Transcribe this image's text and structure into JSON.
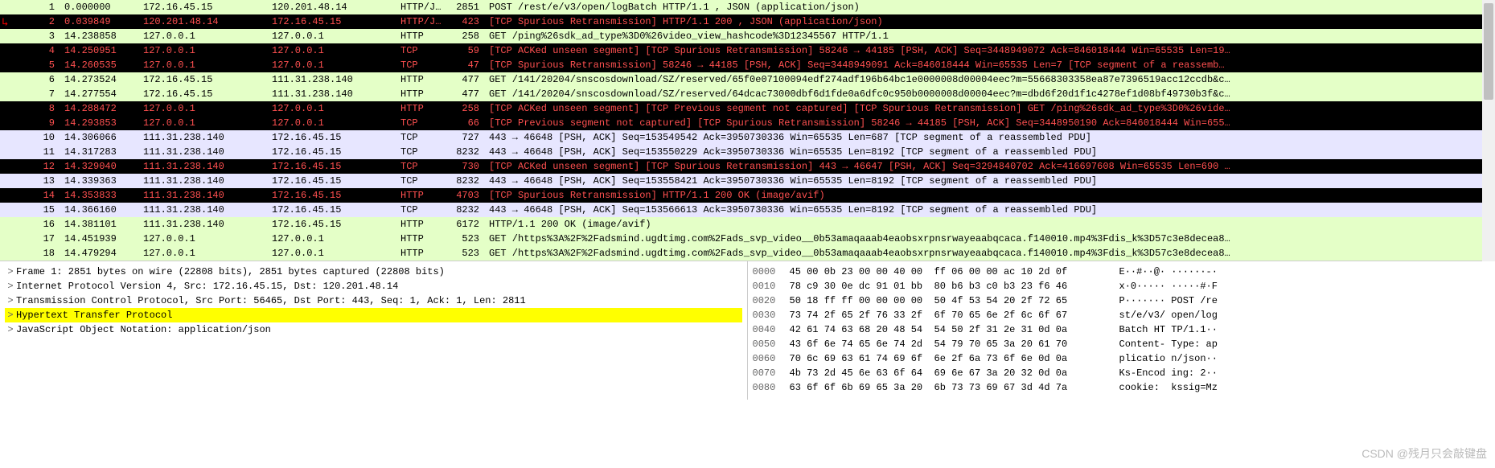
{
  "packets": [
    {
      "cls": "normal",
      "num": "1",
      "time": "0.000000",
      "src": "172.16.45.15",
      "dst": "120.201.48.14",
      "proto": "HTTP/J…",
      "len": "2851",
      "info": "POST /rest/e/v3/open/logBatch HTTP/1.1 , JSON (application/json)"
    },
    {
      "cls": "spurious",
      "num": "2",
      "time": "0.039849",
      "src": "120.201.48.14",
      "dst": "172.16.45.15",
      "proto": "HTTP/J…",
      "len": "423",
      "info": "[TCP Spurious Retransmission] HTTP/1.1 200  , JSON (application/json)"
    },
    {
      "cls": "normal",
      "num": "3",
      "time": "14.238858",
      "src": "127.0.0.1",
      "dst": "127.0.0.1",
      "proto": "HTTP",
      "len": "258",
      "info": "GET /ping%26sdk_ad_type%3D0%26video_view_hashcode%3D12345567 HTTP/1.1"
    },
    {
      "cls": "spurious",
      "num": "4",
      "time": "14.250951",
      "src": "127.0.0.1",
      "dst": "127.0.0.1",
      "proto": "TCP",
      "len": "59",
      "info": "[TCP ACKed unseen segment] [TCP Spurious Retransmission] 58246 → 44185 [PSH, ACK] Seq=3448949072 Ack=846018444 Win=65535 Len=19…"
    },
    {
      "cls": "spurious",
      "num": "5",
      "time": "14.260535",
      "src": "127.0.0.1",
      "dst": "127.0.0.1",
      "proto": "TCP",
      "len": "47",
      "info": "[TCP Spurious Retransmission] 58246 → 44185 [PSH, ACK] Seq=3448949091 Ack=846018444 Win=65535 Len=7 [TCP segment of a reassemb…"
    },
    {
      "cls": "normal",
      "num": "6",
      "time": "14.273524",
      "src": "172.16.45.15",
      "dst": "111.31.238.140",
      "proto": "HTTP",
      "len": "477",
      "info": "GET /141/20204/snscosdownload/SZ/reserved/65f0e07100094edf274adf196b64bc1e0000008d00004eec?m=55668303358ea87e7396519acc12ccdb&c…"
    },
    {
      "cls": "normal",
      "num": "7",
      "time": "14.277554",
      "src": "172.16.45.15",
      "dst": "111.31.238.140",
      "proto": "HTTP",
      "len": "477",
      "info": "GET /141/20204/snscosdownload/SZ/reserved/64dcac73000dbf6d1fde0a6dfc0c950b0000008d00004eec?m=dbd6f20d1f1c4278ef1d08bf49730b3f&c…"
    },
    {
      "cls": "spurious",
      "num": "8",
      "time": "14.288472",
      "src": "127.0.0.1",
      "dst": "127.0.0.1",
      "proto": "HTTP",
      "len": "258",
      "info": "[TCP ACKed unseen segment] [TCP Previous segment not captured] [TCP Spurious Retransmission] GET /ping%26sdk_ad_type%3D0%26vide…"
    },
    {
      "cls": "spurious",
      "num": "9",
      "time": "14.293853",
      "src": "127.0.0.1",
      "dst": "127.0.0.1",
      "proto": "TCP",
      "len": "66",
      "info": "[TCP Previous segment not captured] [TCP Spurious Retransmission] 58246 → 44185 [PSH, ACK] Seq=3448950190 Ack=846018444 Win=655…"
    },
    {
      "cls": "lavender",
      "num": "10",
      "time": "14.306066",
      "src": "111.31.238.140",
      "dst": "172.16.45.15",
      "proto": "TCP",
      "len": "727",
      "info": "443 → 46648 [PSH, ACK] Seq=153549542 Ack=3950730336 Win=65535 Len=687 [TCP segment of a reassembled PDU]"
    },
    {
      "cls": "lavender",
      "num": "11",
      "time": "14.317283",
      "src": "111.31.238.140",
      "dst": "172.16.45.15",
      "proto": "TCP",
      "len": "8232",
      "info": "443 → 46648 [PSH, ACK] Seq=153550229 Ack=3950730336 Win=65535 Len=8192 [TCP segment of a reassembled PDU]"
    },
    {
      "cls": "spurious",
      "num": "12",
      "time": "14.329040",
      "src": "111.31.238.140",
      "dst": "172.16.45.15",
      "proto": "TCP",
      "len": "730",
      "info": "[TCP ACKed unseen segment] [TCP Spurious Retransmission] 443 → 46647 [PSH, ACK] Seq=3294840702 Ack=416697608 Win=65535 Len=690 …"
    },
    {
      "cls": "lavender",
      "num": "13",
      "time": "14.339363",
      "src": "111.31.238.140",
      "dst": "172.16.45.15",
      "proto": "TCP",
      "len": "8232",
      "info": "443 → 46648 [PSH, ACK] Seq=153558421 Ack=3950730336 Win=65535 Len=8192 [TCP segment of a reassembled PDU]"
    },
    {
      "cls": "spurious",
      "num": "14",
      "time": "14.353833",
      "src": "111.31.238.140",
      "dst": "172.16.45.15",
      "proto": "HTTP",
      "len": "4703",
      "info": "[TCP Spurious Retransmission] HTTP/1.1 200 OK  (image/avif)"
    },
    {
      "cls": "lavender",
      "num": "15",
      "time": "14.366160",
      "src": "111.31.238.140",
      "dst": "172.16.45.15",
      "proto": "TCP",
      "len": "8232",
      "info": "443 → 46648 [PSH, ACK] Seq=153566613 Ack=3950730336 Win=65535 Len=8192 [TCP segment of a reassembled PDU]"
    },
    {
      "cls": "normal",
      "num": "16",
      "time": "14.381101",
      "src": "111.31.238.140",
      "dst": "172.16.45.15",
      "proto": "HTTP",
      "len": "6172",
      "info": "HTTP/1.1 200 OK  (image/avif)"
    },
    {
      "cls": "normal",
      "num": "17",
      "time": "14.451939",
      "src": "127.0.0.1",
      "dst": "127.0.0.1",
      "proto": "HTTP",
      "len": "523",
      "info": "GET /https%3A%2F%2Fadsmind.ugdtimg.com%2Fads_svp_video__0b53amaqaaab4eaobsxrpnsrwayeaabqcaca.f140010.mp4%3Fdis_k%3D57c3e8decea8…"
    },
    {
      "cls": "normal",
      "num": "18",
      "time": "14.479294",
      "src": "127.0.0.1",
      "dst": "127.0.0.1",
      "proto": "HTTP",
      "len": "523",
      "info": "GET /https%3A%2F%2Fadsmind.ugdtimg.com%2Fads_svp_video__0b53amaqaaab4eaobsxrpnsrwayeaabqcaca.f140010.mp4%3Fdis_k%3D57c3e8decea8…"
    }
  ],
  "tree": [
    {
      "caret": ">",
      "text": "Frame 1: 2851 bytes on wire (22808 bits), 2851 bytes captured (22808 bits)",
      "hl": false
    },
    {
      "caret": ">",
      "text": "Internet Protocol Version 4, Src: 172.16.45.15, Dst: 120.201.48.14",
      "hl": false
    },
    {
      "caret": ">",
      "text": "Transmission Control Protocol, Src Port: 56465, Dst Port: 443, Seq: 1, Ack: 1, Len: 2811",
      "hl": false
    },
    {
      "caret": ">",
      "text": "Hypertext Transfer Protocol",
      "hl": true
    },
    {
      "caret": ">",
      "text": "JavaScript Object Notation: application/json",
      "hl": false
    }
  ],
  "hex": [
    {
      "off": "0000",
      "bytes": "45 00 0b 23 00 00 40 00  ff 06 00 00 ac 10 2d 0f",
      "ascii": "E··#··@· ······-·"
    },
    {
      "off": "0010",
      "bytes": "78 c9 30 0e dc 91 01 bb  80 b6 b3 c0 b3 23 f6 46",
      "ascii": "x·0····· ·····#·F"
    },
    {
      "off": "0020",
      "bytes": "50 18 ff ff 00 00 00 00  50 4f 53 54 20 2f 72 65",
      "ascii": "P······· POST /re"
    },
    {
      "off": "0030",
      "bytes": "73 74 2f 65 2f 76 33 2f  6f 70 65 6e 2f 6c 6f 67",
      "ascii": "st/e/v3/ open/log"
    },
    {
      "off": "0040",
      "bytes": "42 61 74 63 68 20 48 54  54 50 2f 31 2e 31 0d 0a",
      "ascii": "Batch HT TP/1.1··"
    },
    {
      "off": "0050",
      "bytes": "43 6f 6e 74 65 6e 74 2d  54 79 70 65 3a 20 61 70",
      "ascii": "Content- Type: ap"
    },
    {
      "off": "0060",
      "bytes": "70 6c 69 63 61 74 69 6f  6e 2f 6a 73 6f 6e 0d 0a",
      "ascii": "plicatio n/json··"
    },
    {
      "off": "0070",
      "bytes": "4b 73 2d 45 6e 63 6f 64  69 6e 67 3a 20 32 0d 0a",
      "ascii": "Ks-Encod ing: 2··"
    },
    {
      "off": "0080",
      "bytes": "63 6f 6f 6b 69 65 3a 20  6b 73 73 69 67 3d 4d 7a",
      "ascii": "cookie:  kssig=Mz"
    }
  ],
  "watermark": "CSDN @残月只会敲键盘"
}
